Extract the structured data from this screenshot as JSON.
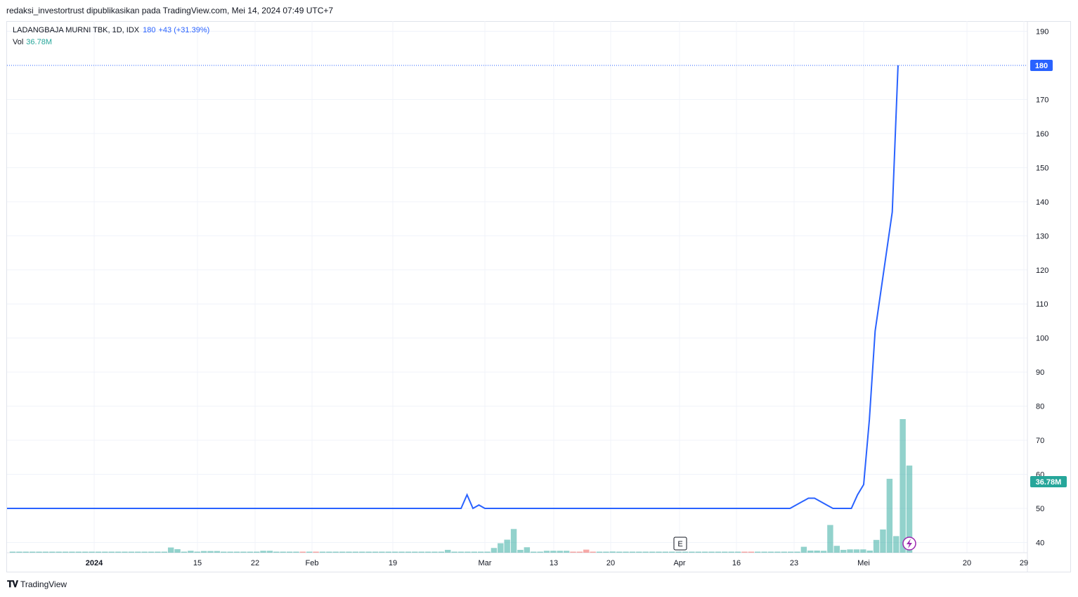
{
  "header": {
    "published_line": "redaksi_investortrust dipublikasikan pada TradingView.com, Mei 14, 2024 07:49 UTC+7"
  },
  "legend": {
    "symbol": "LADANGBAJA MURNI TBK, 1D, IDX",
    "last": "180",
    "change": "+43 (+31.39%)",
    "vol_label": "Vol",
    "vol_value": "36.78M"
  },
  "footer": {
    "brand": "TradingView"
  },
  "colors": {
    "line": "#2962ff",
    "vol_up": "#26a69a",
    "vol_down": "#ef5350",
    "grid": "#f0f3fa",
    "last_price_label": "#2962ff",
    "vol_label_bg": "#26a69a"
  },
  "chart_data": {
    "type": "line",
    "series": [
      {
        "name": "LADANGBAJA MURNI TBK",
        "x": [
          "2023-12-26",
          "2024-01-05",
          "2024-01-15",
          "2024-01-25",
          "2024-02-05",
          "2024-02-15",
          "2024-02-26",
          "2024-02-27",
          "2024-02-28",
          "2024-02-29",
          "2024-03-01",
          "2024-03-05",
          "2024-03-15",
          "2024-03-25",
          "2024-04-05",
          "2024-04-15",
          "2024-04-19",
          "2024-04-22",
          "2024-04-23",
          "2024-04-25",
          "2024-04-26",
          "2024-04-29",
          "2024-04-30",
          "2024-05-01",
          "2024-05-02",
          "2024-05-03",
          "2024-05-06",
          "2024-05-07",
          "2024-05-08",
          "2024-05-13"
        ],
        "values": [
          50,
          50,
          50,
          50,
          50,
          50,
          50,
          54,
          50,
          51,
          50,
          50,
          50,
          50,
          50,
          50,
          50,
          53,
          53,
          51,
          50,
          50,
          54,
          57,
          76,
          102,
          137,
          180,
          180,
          180
        ]
      }
    ],
    "volume_bars": {
      "name": "Vol",
      "last_value": "36.78M",
      "values_M": [
        0.3,
        0.3,
        0.3,
        0.3,
        0.3,
        0.3,
        0.3,
        0.3,
        0.3,
        0.3,
        0.3,
        0.3,
        0.3,
        0.3,
        0.3,
        0.3,
        0.3,
        0.3,
        0.3,
        0.3,
        0.3,
        0.3,
        0.3,
        0.3,
        2.2,
        1.5,
        0.4,
        0.8,
        0.4,
        0.7,
        0.7,
        0.7,
        0.3,
        0.3,
        0.3,
        0.3,
        0.3,
        0.3,
        0.8,
        0.8,
        0.3,
        0.3,
        0.3,
        0.3,
        0.3,
        0.3,
        0.3,
        0.3,
        0.3,
        0.3,
        0.3,
        0.3,
        0.3,
        0.3,
        0.3,
        0.3,
        0.3,
        0.3,
        0.3,
        0.3,
        0.3,
        0.3,
        0.3,
        0.3,
        0.3,
        0.3,
        1.2,
        0.3,
        0.3,
        0.3,
        0.3,
        0.3,
        0.3,
        2.0,
        4.0,
        5.5,
        10.0,
        1.2,
        2.3,
        0.3,
        0.3,
        0.8,
        0.8,
        0.8,
        0.8,
        0.3,
        0.3,
        1.3,
        0.3,
        0.3,
        0.3,
        0.5,
        0.3,
        0.3,
        0.3,
        0.3,
        0.3,
        0.3,
        0.3,
        0.3,
        0.3,
        0.3,
        0.3,
        0.3,
        0.3,
        0.3,
        0.3,
        0.3,
        0.3,
        0.3,
        0.3,
        0.3,
        0.3,
        0.3,
        0.3,
        0.3,
        0.3,
        0.3,
        0.3,
        0.3,
        2.5,
        0.9,
        0.9,
        0.8,
        11.7,
        2.9,
        1.2,
        1.4,
        1.4,
        1.4,
        0.9,
        5.4,
        9.8,
        31.2,
        7.0,
        56.4,
        36.78
      ],
      "down_indices": [
        44,
        46,
        85,
        86,
        87,
        88,
        111,
        112
      ]
    },
    "y_ticks": [
      40,
      50,
      60,
      70,
      80,
      90,
      100,
      110,
      120,
      130,
      140,
      150,
      160,
      170,
      190
    ],
    "y_range": [
      37,
      193
    ],
    "last_price_label": "180",
    "x_ticks": [
      {
        "label": "2024",
        "bold": true
      },
      {
        "label": "15"
      },
      {
        "label": "22"
      },
      {
        "label": "Feb"
      },
      {
        "label": "19"
      },
      {
        "label": "Mar"
      },
      {
        "label": "13"
      },
      {
        "label": "20"
      },
      {
        "label": "Apr"
      },
      {
        "label": "16"
      },
      {
        "label": "23"
      },
      {
        "label": "Mei"
      },
      {
        "label": "20"
      },
      {
        "label": "29"
      }
    ],
    "events": [
      {
        "label": "E"
      }
    ]
  }
}
